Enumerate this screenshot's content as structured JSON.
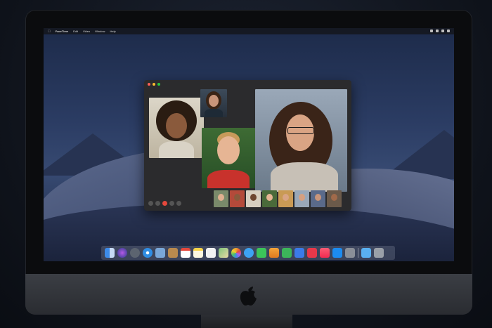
{
  "menubar": {
    "app_name": "FaceTime",
    "items": [
      "Edit",
      "Video",
      "Window",
      "Help"
    ]
  },
  "window": {
    "controls": [
      "close",
      "minimize",
      "zoom"
    ],
    "call_buttons": [
      "sidebar-icon",
      "mute-icon",
      "end-call-icon",
      "camera-off-icon",
      "effects-icon"
    ]
  },
  "participants": {
    "main_tiles": [
      "participant-curly-hair",
      "participant-top",
      "participant-center",
      "participant-glasses"
    ],
    "strip_count": 8
  },
  "dock": {
    "apps": [
      "finder-icon",
      "siri-icon",
      "launchpad-icon",
      "safari-icon",
      "photos-icon",
      "contacts-icon",
      "calendar-icon",
      "notes-icon",
      "reminders-icon",
      "maps-icon",
      "photos-app-icon",
      "messages-icon",
      "facetime-icon",
      "pages-icon",
      "numbers-icon",
      "keynote-icon",
      "news-icon",
      "music-icon",
      "app-store-icon",
      "system-preferences-icon",
      "downloads-folder-icon",
      "trash-icon"
    ]
  },
  "colors": {
    "close": "#fc5f57",
    "minimize": "#fdbc2e",
    "zoom": "#28c840",
    "end_call": "#e5483c"
  }
}
